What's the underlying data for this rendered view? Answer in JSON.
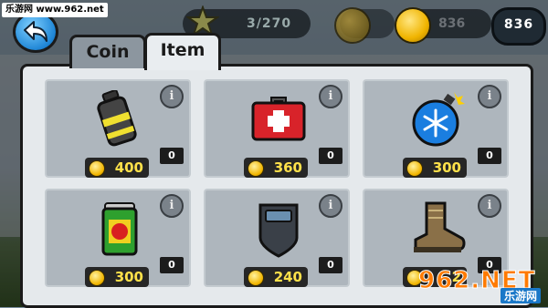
{
  "watermark_top": "乐游网 www.962.net",
  "watermark_logo": {
    "brand": "962.NET",
    "sub": "乐游网"
  },
  "header": {
    "stars": "3/270",
    "coins_faded": "836",
    "coins_total": "836"
  },
  "tabs": [
    {
      "label": "Coin",
      "active": false
    },
    {
      "label": "Item",
      "active": true
    }
  ],
  "items": [
    {
      "icon": "grenade-icon",
      "quantity": "0",
      "price": "400",
      "info": "i"
    },
    {
      "icon": "first-aid-kit-icon",
      "quantity": "0",
      "price": "360",
      "info": "i"
    },
    {
      "icon": "freeze-bomb-icon",
      "quantity": "0",
      "price": "300",
      "info": "i"
    },
    {
      "icon": "energy-drink-icon",
      "quantity": "0",
      "price": "300",
      "info": "i"
    },
    {
      "icon": "armor-shield-icon",
      "quantity": "0",
      "price": "240",
      "info": "i"
    },
    {
      "icon": "boot-icon",
      "quantity": "0",
      "price": "2",
      "info": "i"
    }
  ],
  "colors": {
    "price_text": "#ffe14a",
    "panel_bg": "#e5e9ec",
    "card_bg": "#aeb6bd",
    "back_button": "#1f86d6"
  }
}
